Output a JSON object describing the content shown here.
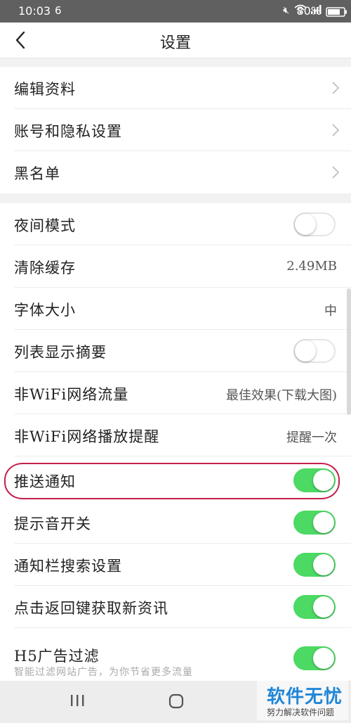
{
  "status_bar": {
    "time": "10:03",
    "app_icon": "6",
    "battery": "80%",
    "icons": [
      "mute-icon",
      "wifi-icon",
      "signal-icon",
      "battery-icon"
    ]
  },
  "header": {
    "title": "设置",
    "back_icon": "chevron-left-icon"
  },
  "group1": [
    {
      "label": "编辑资料"
    },
    {
      "label": "账号和隐私设置"
    },
    {
      "label": "黑名单"
    }
  ],
  "group2": {
    "night_mode": {
      "label": "夜间模式",
      "on": false
    },
    "clear_cache": {
      "label": "清除缓存",
      "value": "2.49MB"
    },
    "font_size": {
      "label": "字体大小",
      "value": "中"
    },
    "list_summary": {
      "label": "列表显示摘要",
      "on": false
    },
    "non_wifi_traffic": {
      "label": "非WiFi网络流量",
      "value": "最佳效果(下载大图)"
    },
    "non_wifi_playback": {
      "label": "非WiFi网络播放提醒",
      "value": "提醒一次"
    },
    "push": {
      "label": "推送通知",
      "on": true
    },
    "sound": {
      "label": "提示音开关",
      "on": true
    },
    "notif_search": {
      "label": "通知栏搜索设置",
      "on": true
    },
    "back_refresh": {
      "label": "点击返回键获取新资讯",
      "on": true
    },
    "h5_filter": {
      "label": "H5广告过滤",
      "sublabel": "智能过滤网站广告，为你节省更多流量",
      "on": true
    }
  },
  "colors": {
    "toggle_on": "#4cd964",
    "highlight": "#c2204a",
    "watermark_blue": "#1f86d8"
  },
  "watermark": {
    "title": "软件无忧",
    "subtitle": "努力解决软件问题"
  }
}
